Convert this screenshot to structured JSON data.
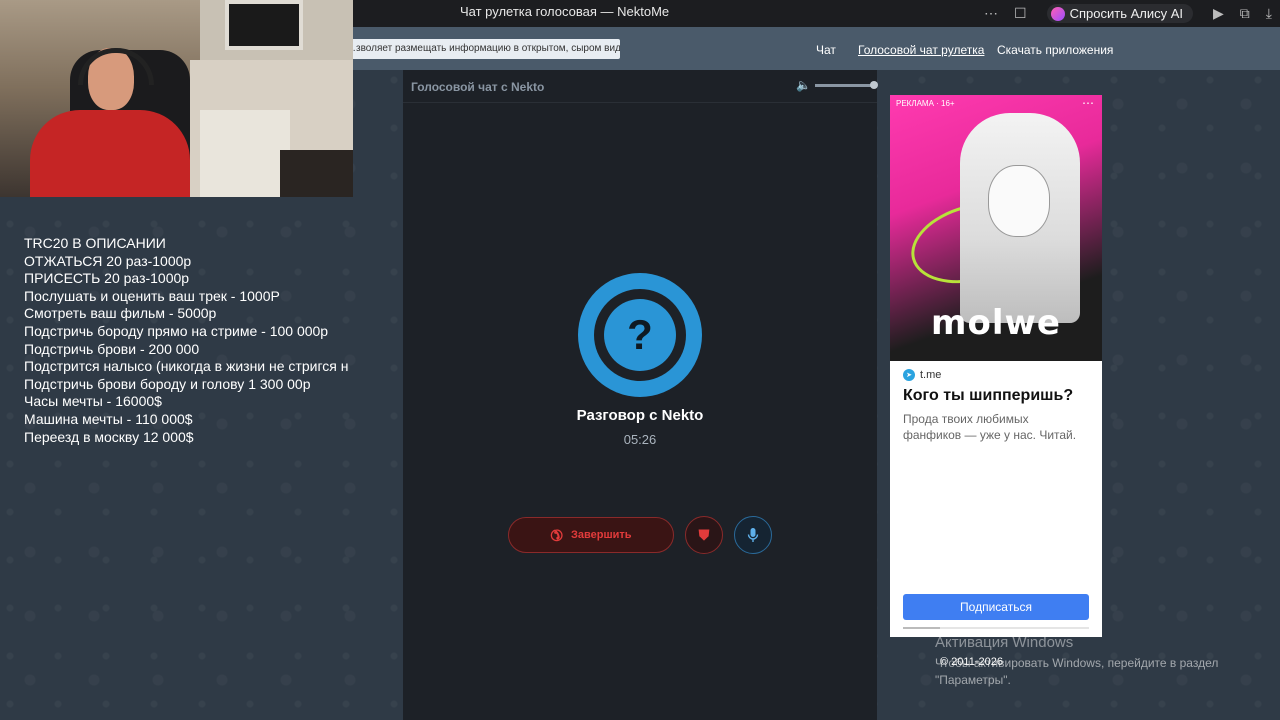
{
  "browser": {
    "tab_title": "Чат рулетка голосовая — NektoMe",
    "alice_label": "Спросить Алису AI"
  },
  "header": {
    "notice": "…зволяет размещать информацию в открытом, сыром виде!",
    "nav": [
      "Чат",
      "Голосовой чат рулетка",
      "Скачать приложения"
    ]
  },
  "overlay": {
    "lines": [
      "TRC20 В ОПИСАНИИ",
      "ОТЖАТЬСЯ 20 раз-1000р",
      "ПРИСЕСТЬ 20 раз-1000р",
      "Послушать и оценить ваш трек - 1000Р",
      "Смотреть ваш фильм - 5000р",
      "Подстричь бороду прямо на стриме - 100 000р",
      "Подстричь брови - 200 000",
      "Подстрится налысо (никогда в жизни не стригся н",
      "Подстричь брови бороду и голову 1 300 00р",
      "Часы мечты - 16000$",
      "Машина мечты - 110 000$",
      "Переезд в москву 12 000$"
    ]
  },
  "panel": {
    "title": "Голосовой чат с Nekto",
    "avatar_glyph": "?",
    "conversation_title": "Разговор с Nekto",
    "timer": "05:26",
    "end_label": "Завершить",
    "volume_level": 1.0
  },
  "ad": {
    "label": "РЕКЛАМА · 16+",
    "brand": "molwe",
    "domain": "t.me",
    "headline": "Кого ты шипперишь?",
    "description": "Прода твоих любимых фанфиков — уже у нас. Читай.",
    "cta": "Подписаться",
    "progress": 0.2
  },
  "footer": {
    "copyright": "© 2011-2026",
    "watermark_title": "Активация Windows",
    "watermark_text": "Чтобы активировать Windows, перейдите в раздел \"Параметры\"."
  },
  "colors": {
    "accent_blue": "#2a95d6",
    "end_red": "#e23b3b",
    "header_bg": "#4a5a6a",
    "panel_bg": "#1d2127"
  }
}
